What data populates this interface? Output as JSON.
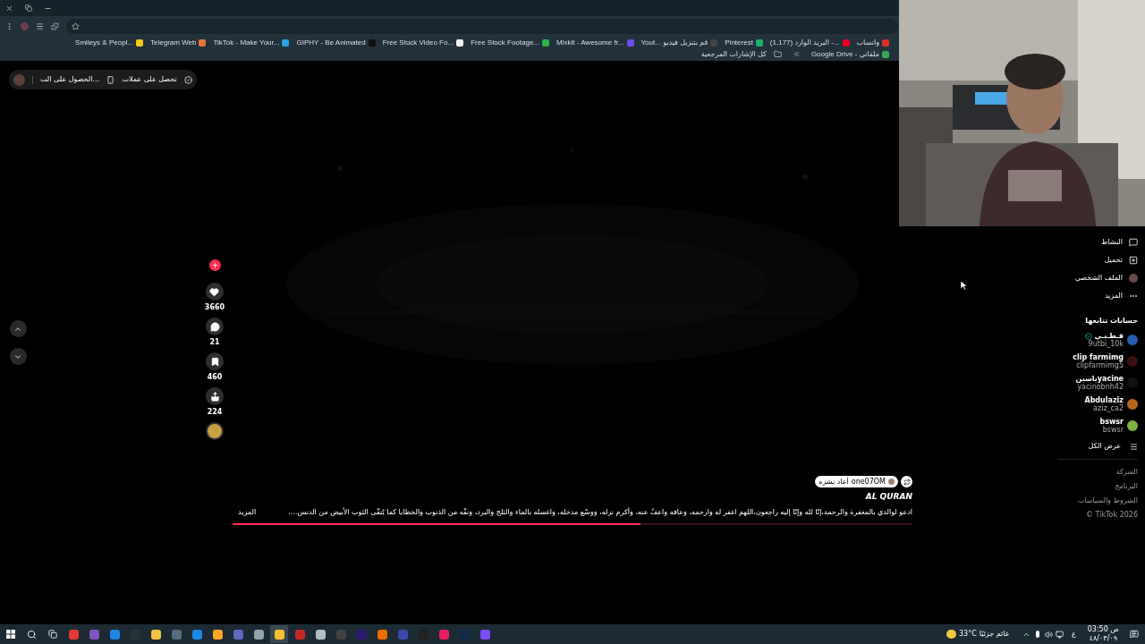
{
  "bookmarks_bar": {
    "all_bookmarks": "كل الإشارات المرجعية",
    "items": [
      {
        "label": "واتساب",
        "color": "#d93025"
      },
      {
        "label": "(1,177) البريد الوارد -...",
        "color": "#e60023"
      },
      {
        "label": "Pinterest",
        "color": "#1fae6b"
      },
      {
        "label": "Yout... قم بتنزيل فيديو",
        "color": "#444444"
      },
      {
        "label": "Mixkit - Awesome fr...",
        "color": "#6b4cf0"
      },
      {
        "label": "Free Stock Footage...",
        "color": "#2fb34a"
      },
      {
        "label": "Free Stock Video Fo...",
        "color": "#f2f2f2"
      },
      {
        "label": "GIPHY - Be Animated",
        "color": "#111111"
      },
      {
        "label": "TikTok - Make Your...",
        "color": "#2aa3e0"
      },
      {
        "label": "Telegram Web",
        "color": "#e8743b"
      },
      {
        "label": "Smileys & Peopl...",
        "color": "#f5c518"
      },
      {
        "label": "Google Drive - ملفاتي",
        "color": "#34a853"
      }
    ]
  },
  "top_pill": {
    "coins": "تحصل على عملات",
    "app": "الحصول على الت…"
  },
  "actions": [
    {
      "kind": "add"
    },
    {
      "kind": "like",
      "count": "3660"
    },
    {
      "kind": "comment",
      "count": "21"
    },
    {
      "kind": "bookmark",
      "count": "460"
    },
    {
      "kind": "share",
      "count": "224"
    },
    {
      "kind": "sound"
    }
  ],
  "post": {
    "reposter": "one07OM",
    "repost_label": "أعاد نشره",
    "title": "AL QURAN",
    "description": "ادعو لوالدي بالمغفرة والرحمة،إنّا لله وإنّا إليه راجعون،اللهم اغفر له وارحمه، وعافه واعفُ عنه، وأكرم نزله، ووسّع مدخله، واغسله بالماء والثلج والبرد، ونقّه من الذنوب والخطايا كما يُنقّى الثوب الأبيض من الدنس....",
    "more": "المزيد",
    "progress": {
      "level": 0.6
    }
  },
  "sidebar": {
    "nav": [
      {
        "kind": "activity",
        "label": "النشاط"
      },
      {
        "kind": "upload",
        "label": "تحميل"
      },
      {
        "kind": "profile",
        "label": "الملف الشخصي"
      },
      {
        "kind": "more",
        "label": "المزيد"
      }
    ],
    "following_title": "حسابات تتابعها",
    "following": [
      {
        "name": "قـطـبـي",
        "handle": "9utbi_10k",
        "verified": true,
        "color": "#2a5db0"
      },
      {
        "name": "clip farmimg",
        "handle": "clipfarmimg5",
        "verified": false,
        "color": "#3a1010"
      },
      {
        "name": "ياسينyacine",
        "handle": "yacinobnh42",
        "verified": false,
        "color": "#111111"
      },
      {
        "name": "Abdulaziz",
        "handle": "aziz_ca2",
        "verified": false,
        "color": "#b5651d"
      },
      {
        "name": "bswsr",
        "handle": "bswsr",
        "verified": false,
        "color": "#7cb342"
      }
    ],
    "see_all": "عرض الكل",
    "footer": [
      "الشركة",
      "البرنامج",
      "الشروط والسياسات",
      "© TikTok 2026"
    ]
  },
  "taskbar": {
    "apps": [
      {
        "color": "#e53935"
      },
      {
        "color": "#7e57c2"
      },
      {
        "color": "#1e88e5"
      },
      {
        "color": "#263238"
      },
      {
        "color": "#f4c542"
      },
      {
        "color": "#546e7a"
      },
      {
        "color": "#1e88e5"
      },
      {
        "color": "#f9a825"
      },
      {
        "color": "#5c6bc0"
      },
      {
        "color": "#90a4ae"
      },
      {
        "color": "#fbc02d",
        "selected": true
      },
      {
        "color": "#c62828"
      },
      {
        "color": "#b0bec5"
      },
      {
        "color": "#424242"
      },
      {
        "color": "#2a1a6e"
      },
      {
        "color": "#ef6c00"
      },
      {
        "color": "#3949ab"
      },
      {
        "color": "#212121"
      },
      {
        "color": "#e91e63"
      },
      {
        "color": "#0d2a4a"
      },
      {
        "color": "#7c4dff"
      }
    ],
    "temperature": "33°C",
    "weather": "غائم جزئيًا",
    "language": "ع",
    "time": "03:50 ص",
    "date": "٤٨/٠٣/٠٩"
  }
}
